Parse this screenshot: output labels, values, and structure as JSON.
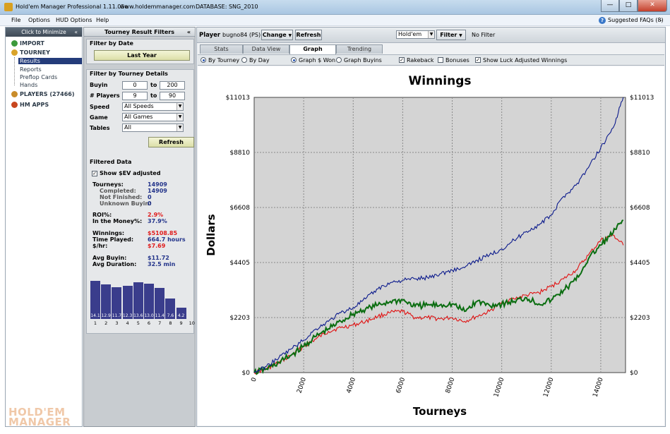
{
  "window": {
    "title": "Hold'em Manager Professional 1.11.05e",
    "url": "www.holdemmanager.com",
    "database": "DATABASE: SNG_2010",
    "minimize_glyph": "—",
    "maximize_glyph": "□",
    "close_glyph": "✕"
  },
  "menu": {
    "file": "File",
    "options": "Options",
    "hud_options": "HUD Options",
    "help": "Help",
    "faq": "Suggested FAQs (8)",
    "help_icon": "?",
    "faq_chevron": "⌄"
  },
  "leftnav": {
    "minimize_label": "Click to Minimize",
    "minimize_chevron": "«",
    "import": "IMPORT",
    "tourney": "TOURNEY",
    "results": "Results",
    "reports": "Reports",
    "preflop_cards": "Preflop Cards",
    "hands": "Hands",
    "players": "PLAYERS (27466)",
    "hm_apps": "HM APPS",
    "logo_line1": "HOLD'EM",
    "logo_line2": "MANAGER"
  },
  "filters": {
    "header": "Tourney Result Filters",
    "header_chevron": "«",
    "filter_by_date": "Filter by Date",
    "date_button": "Last Year",
    "filter_by_details": "Filter by Tourney Details",
    "buyin_label": "Buyin",
    "buyin_min": "0",
    "buyin_max": "200",
    "players_label": "# Players",
    "players_min": "9",
    "players_max": "90",
    "to": "to",
    "speed_label": "Speed",
    "speed_value": "All Speeds",
    "game_label": "Game",
    "game_value": "All Games",
    "tables_label": "Tables",
    "tables_value": "All",
    "dropdown_glyph": "▼",
    "refresh": "Refresh"
  },
  "filtered_data": {
    "title": "Filtered Data",
    "show_sev_label": "Show $EV adjusted",
    "show_sev_checked": "✓",
    "tourneys_label": "Tourneys:",
    "tourneys": "14909",
    "completed_label": "Completed:",
    "completed": "14909",
    "not_finished_label": "Not Finished:",
    "not_finished": "0",
    "unknown_buyin_label": "Unknown Buyin:",
    "unknown_buyin": "0",
    "roi_label": "ROI%:",
    "roi": "2.9%",
    "itm_label": "In the Money%:",
    "itm": "37.9%",
    "winnings_label": "Winnings:",
    "winnings": "$5108.85",
    "time_played_label": "Time Played:",
    "time_played": "664.7 hours",
    "per_hour_label": "$/hr:",
    "per_hour": "$7.69",
    "avg_buyin_label": "Avg Buyin:",
    "avg_buyin": "$11.72",
    "avg_duration_label": "Avg Duration:",
    "avg_duration": "32.5 min",
    "finish_dist": {
      "categories": [
        "1",
        "2",
        "3",
        "4",
        "5",
        "6",
        "7",
        "8",
        "9",
        "10"
      ],
      "values": [
        14.1,
        12.9,
        11.7,
        12.3,
        13.6,
        13.0,
        11.4,
        7.6,
        4.2,
        0
      ],
      "labels": [
        "14.1",
        "12.9",
        "11.7",
        "12.3",
        "13.6",
        "13.0",
        "11.4",
        "7.6",
        "4.2",
        ""
      ]
    }
  },
  "toolbar": {
    "player_label": "Player",
    "player_name": "bugno84 (PS)",
    "change": "Change",
    "refresh": "Refresh",
    "game_select": "Hold'em",
    "filter": "Filter",
    "no_filter": "No Filter"
  },
  "tabs": {
    "stats": "Stats",
    "data_view": "Data View",
    "graph": "Graph",
    "trending": "Trending"
  },
  "options": {
    "by_tourney": "By Tourney",
    "by_day": "By Day",
    "graph_won": "Graph $ Won",
    "graph_buyins": "Graph Buyins",
    "rakeback": "Rakeback",
    "bonuses": "Bonuses",
    "luck_adjusted": "Show Luck Adjusted Winnings",
    "check": "✓"
  },
  "chart_data": {
    "type": "line",
    "title": "Winnings",
    "xlabel": "Tourneys",
    "ylabel": "Dollars",
    "xlim": [
      0,
      15000
    ],
    "ylim": [
      0,
      11013
    ],
    "x_ticks": [
      "0",
      "2000",
      "4000",
      "6000",
      "8000",
      "10000",
      "12000",
      "14000"
    ],
    "y_ticks": [
      "$0",
      "$2203",
      "$4405",
      "$6608",
      "$8810",
      "$11013"
    ],
    "grid": true,
    "colors": {
      "blue": "#0b1a8c",
      "green": "#0a6d10",
      "red": "#e01010",
      "plot_bg": "#d4d4d4"
    },
    "x": [
      0,
      500,
      1000,
      1500,
      2000,
      2500,
      3000,
      3500,
      4000,
      4500,
      5000,
      5500,
      6000,
      6500,
      7000,
      7500,
      8000,
      8500,
      9000,
      9500,
      10000,
      10500,
      11000,
      11500,
      12000,
      12500,
      13000,
      13500,
      14000,
      14500,
      14909
    ],
    "series": [
      {
        "color": "blue",
        "values": [
          0,
          250,
          600,
          950,
          1300,
          1750,
          2050,
          2400,
          2600,
          2950,
          3350,
          3600,
          3700,
          3750,
          3800,
          3950,
          4100,
          4200,
          4500,
          4700,
          4950,
          5300,
          5650,
          5900,
          6300,
          7050,
          7500,
          8200,
          9000,
          9800,
          11013
        ]
      },
      {
        "color": "green",
        "values": [
          0,
          150,
          400,
          700,
          1050,
          1450,
          1750,
          2050,
          2350,
          2550,
          2700,
          2850,
          2900,
          2650,
          2700,
          2700,
          2750,
          2450,
          2850,
          2700,
          2750,
          2850,
          3000,
          2750,
          2900,
          3300,
          3700,
          4550,
          5100,
          5600,
          6100
        ]
      },
      {
        "color": "red",
        "values": [
          0,
          150,
          400,
          700,
          1050,
          1350,
          1650,
          1800,
          1900,
          2050,
          2250,
          2400,
          2450,
          2200,
          2200,
          2150,
          2200,
          2050,
          2250,
          2450,
          2800,
          2950,
          3100,
          3200,
          3450,
          3750,
          4100,
          4700,
          5300,
          5500,
          5100
        ]
      }
    ]
  }
}
